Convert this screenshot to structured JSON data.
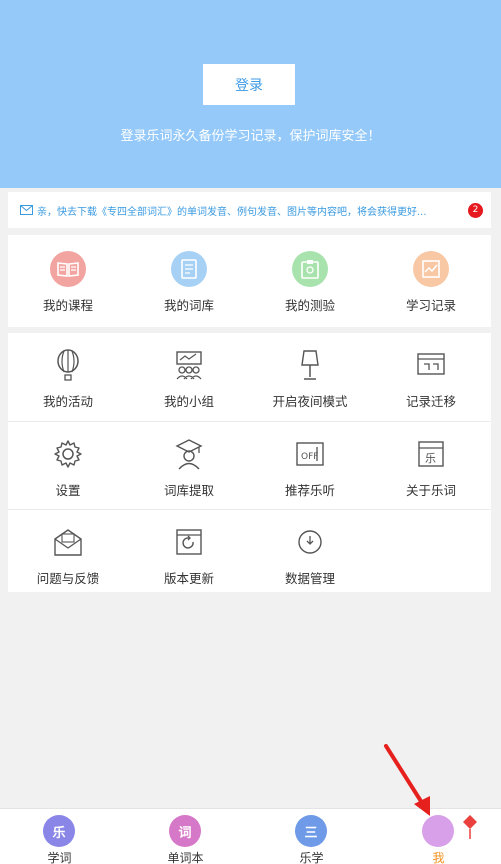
{
  "header": {
    "login_label": "登录",
    "tip": "登录乐词永久备份学习记录，保护词库安全！"
  },
  "notice": {
    "text": "亲，快去下载《专四全部词汇》的单词发音、例句发音、图片等内容吧，将会获得更好...",
    "badge": "2",
    "accent": "#3a9ae0"
  },
  "top_menu": [
    {
      "label": "我的课程",
      "icon": "book-icon",
      "color": "#f2a4a0"
    },
    {
      "label": "我的词库",
      "icon": "wordbank-icon",
      "color": "#a7d1f4"
    },
    {
      "label": "我的测验",
      "icon": "quiz-icon",
      "color": "#a8e3ad"
    },
    {
      "label": "学习记录",
      "icon": "record-chart-icon",
      "color": "#f8c8a5"
    }
  ],
  "grid": [
    {
      "label": "我的活动",
      "icon": "balloon-icon"
    },
    {
      "label": "我的小组",
      "icon": "group-icon"
    },
    {
      "label": "开启夜间模式",
      "icon": "lamp-icon"
    },
    {
      "label": "记录迁移",
      "icon": "migrate-icon"
    },
    {
      "label": "设置",
      "icon": "gear-icon"
    },
    {
      "label": "词库提取",
      "icon": "graduate-icon"
    },
    {
      "label": "推荐乐听",
      "icon": "radio-icon"
    },
    {
      "label": "关于乐词",
      "icon": "about-icon"
    },
    {
      "label": "问题与反馈",
      "icon": "feedback-mail-icon"
    },
    {
      "label": "版本更新",
      "icon": "update-icon"
    },
    {
      "label": "数据管理",
      "icon": "data-clock-icon"
    }
  ],
  "tabs": [
    {
      "label": "学词",
      "glyph": "乐",
      "color": "#8a86e8"
    },
    {
      "label": "单词本",
      "glyph": "词",
      "color": "#d678c8"
    },
    {
      "label": "乐学",
      "glyph": "三",
      "color": "#6e9ae8"
    },
    {
      "label": "我",
      "glyph": "",
      "color": "#d8a0e8"
    }
  ]
}
